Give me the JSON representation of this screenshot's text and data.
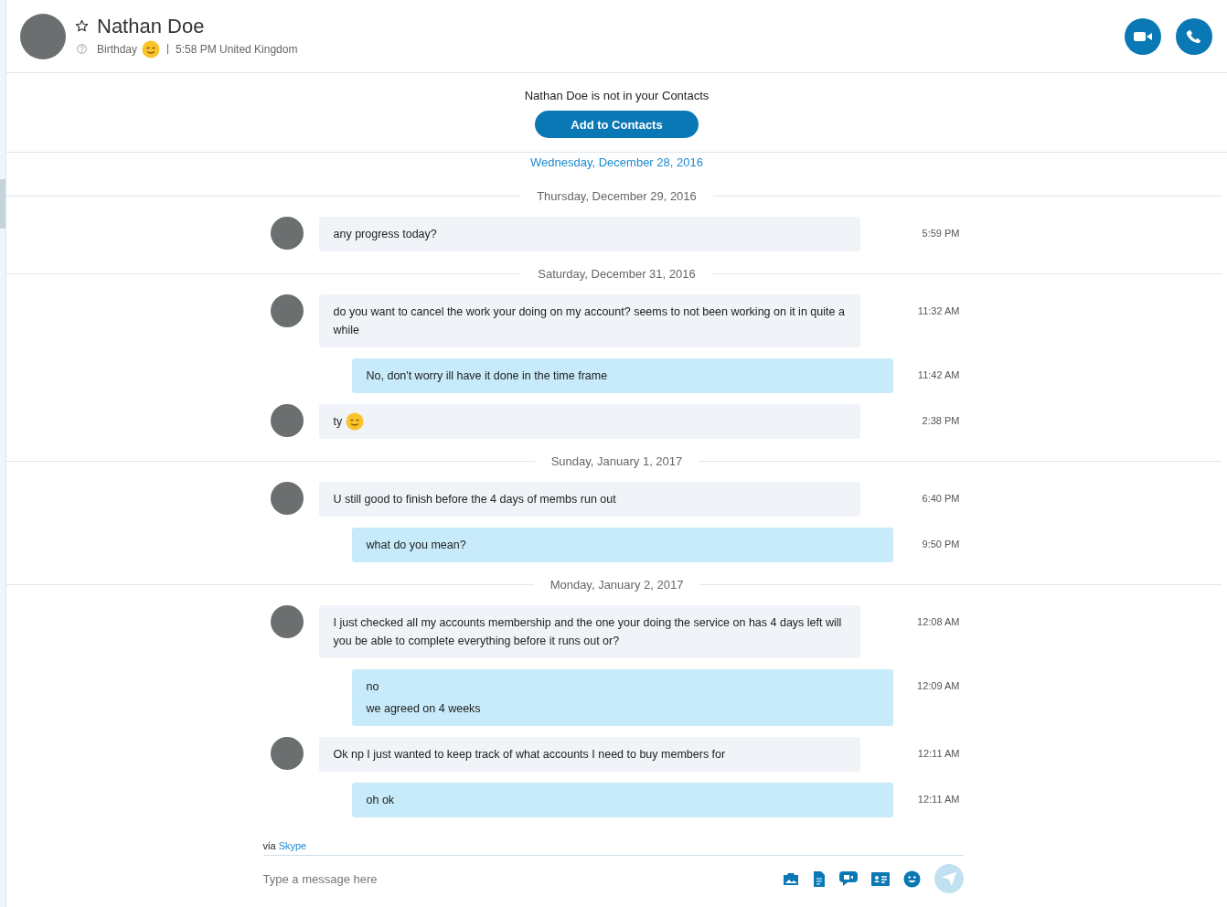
{
  "contact": {
    "name": "Nathan Doe",
    "favorite": false,
    "mood": "Birthday",
    "mood_emoji": true,
    "local_time": "5:58 PM United Kingdom"
  },
  "banner": {
    "text": "Nathan Doe is not in your Contacts",
    "button": "Add to Contacts"
  },
  "earlier_date": "Wednesday, December 28, 2016",
  "conversation": [
    {
      "kind": "date",
      "text": "Thursday, December 29, 2016"
    },
    {
      "kind": "message",
      "outgoing": false,
      "lines": [
        "any progress today?"
      ],
      "emoji": false,
      "time": "5:59 PM"
    },
    {
      "kind": "date",
      "text": "Saturday, December 31, 2016"
    },
    {
      "kind": "message",
      "outgoing": false,
      "lines": [
        "do you want to cancel the work your doing on my account? seems to not been working on it in quite a while"
      ],
      "emoji": false,
      "time": "11:32 AM"
    },
    {
      "kind": "message",
      "outgoing": true,
      "lines": [
        "No, don't worry ill have it done in the time frame"
      ],
      "emoji": false,
      "time": "11:42 AM"
    },
    {
      "kind": "message",
      "outgoing": false,
      "lines": [
        "ty"
      ],
      "emoji": true,
      "time": "2:38 PM"
    },
    {
      "kind": "date",
      "text": "Sunday, January 1, 2017"
    },
    {
      "kind": "message",
      "outgoing": false,
      "lines": [
        "U still good to finish before the 4 days of membs run out"
      ],
      "emoji": false,
      "time": "6:40 PM"
    },
    {
      "kind": "message",
      "outgoing": true,
      "lines": [
        "what do you mean?"
      ],
      "emoji": false,
      "time": "9:50 PM"
    },
    {
      "kind": "date",
      "text": "Monday, January 2, 2017"
    },
    {
      "kind": "message",
      "outgoing": false,
      "lines": [
        "I just checked all my accounts membership and the one your doing the service on has 4 days left will you be able to complete everything before it runs out or?"
      ],
      "emoji": false,
      "time": "12:08 AM"
    },
    {
      "kind": "message",
      "outgoing": true,
      "lines": [
        "no",
        "we agreed on 4 weeks"
      ],
      "emoji": false,
      "time": "12:09 AM"
    },
    {
      "kind": "message",
      "outgoing": false,
      "lines": [
        "Ok np I just wanted to keep track of what accounts I need to buy members for"
      ],
      "emoji": false,
      "time": "12:11 AM"
    },
    {
      "kind": "message",
      "outgoing": true,
      "lines": [
        "oh ok"
      ],
      "emoji": false,
      "time": "12:11 AM"
    }
  ],
  "via": {
    "prefix": "via",
    "service": "Skype"
  },
  "composer": {
    "placeholder": "Type a message here"
  }
}
